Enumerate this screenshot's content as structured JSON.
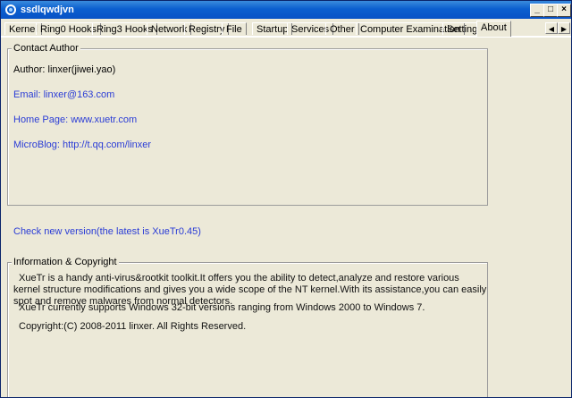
{
  "window": {
    "title": "ssdlqwdjvn"
  },
  "tabs": [
    "Kernel",
    "Ring0 Hooks",
    "Ring3 Hooks",
    "Network",
    "Registry",
    "File",
    "Startup",
    "Services",
    "Other",
    "Computer Examination",
    "Setting",
    "About"
  ],
  "contact": {
    "group_label": "Contact Author",
    "author": "Author: linxer(jiwei.yao)",
    "email": "Email: linxer@163.com",
    "homepage": "Home Page: www.xuetr.com",
    "microblog": "MicroBlog: http://t.qq.com/linxer"
  },
  "check_version": "Check new version(the latest is XueTr0.45)",
  "info": {
    "group_label": "Information & Copyright",
    "para1": "XueTr is a handy anti-virus&rootkit toolkit.It offers you the ability to detect,analyze and restore various kernel structure modifications and gives you a wide scope of the NT kernel.With its assistance,you can easily spot and remove malwares from normal detectors.",
    "para2": "XueTr currently supports Windows 32-bit versions ranging from Windows 2000 to Windows 7.",
    "para3": "Copyright:(C) 2008-2011 linxer. All Rights Reserved."
  },
  "colors": {
    "titlebar": "#0b5fcf",
    "link": "#2a3cd6"
  }
}
